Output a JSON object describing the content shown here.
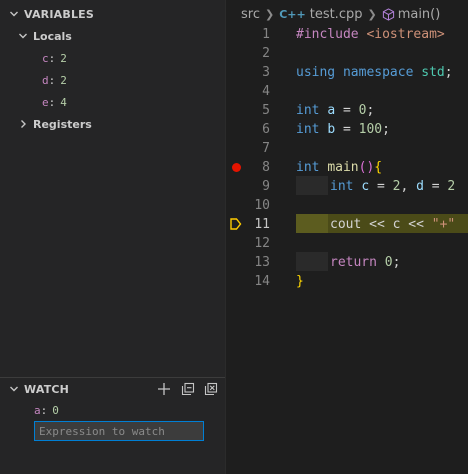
{
  "sidebar": {
    "variables_title": "VARIABLES",
    "locals_label": "Locals",
    "locals": [
      {
        "name": "c",
        "value": "2"
      },
      {
        "name": "d",
        "value": "2"
      },
      {
        "name": "e",
        "value": "4"
      }
    ],
    "registers_label": "Registers",
    "watch_title": "WATCH",
    "watch_items": [
      {
        "name": "a",
        "value": "0"
      }
    ],
    "watch_placeholder": "Expression to watch"
  },
  "editor": {
    "breadcrumb": {
      "folder": "src",
      "file": "test.cpp",
      "file_icon": "C++",
      "symbol": "main()"
    },
    "line_numbers": [
      "1",
      "2",
      "3",
      "4",
      "5",
      "6",
      "7",
      "8",
      "9",
      "10",
      "11",
      "12",
      "13",
      "14"
    ],
    "current_line": "11",
    "breakpoint_line": "8",
    "code": {
      "l1_a": "#include",
      "l1_b": "<iostream>",
      "l3_a": "using",
      "l3_b": "namespace",
      "l3_c": "std",
      "l3_d": ";",
      "l5_a": "int",
      "l5_b": "a",
      "l5_c": " = ",
      "l5_d": "0",
      "l5_e": ";",
      "l6_a": "int",
      "l6_b": "b",
      "l6_c": " = ",
      "l6_d": "100",
      "l6_e": ";",
      "l8_a": "int",
      "l8_b": "main",
      "l8_c": "()",
      "l8_d": "{",
      "l9_a": "int",
      "l9_b": "c",
      "l9_c": " = ",
      "l9_d": "2",
      "l9_e": ", ",
      "l9_f": "d",
      "l9_g": " = ",
      "l9_h": "2",
      "l11_a": "cout << c << ",
      "l11_b": "\"+\"",
      "l13_a": "return",
      "l13_b": "0",
      "l13_c": ";",
      "l14_a": "}"
    }
  },
  "colors": {
    "accent": "#007fd4",
    "breakpoint": "#e51400",
    "current_line_bg": "#4b4b18",
    "stack_frame_arrow": "#ffcc00"
  }
}
